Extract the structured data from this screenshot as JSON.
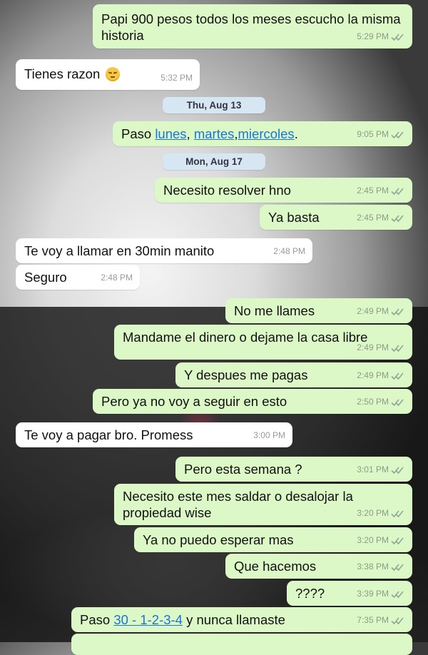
{
  "messages": [
    {
      "id": "m1",
      "dir": "out",
      "text": "Papi 900 pesos todos los meses escucho la misma historia",
      "time": "5:29 PM"
    },
    {
      "id": "m2",
      "dir": "in",
      "text": "Tienes razon",
      "emoji": "pensive-face",
      "time": "5:32 PM"
    },
    {
      "id": "d1",
      "type": "date",
      "text": "Thu, Aug 13"
    },
    {
      "id": "m3",
      "dir": "out",
      "prefix": "Paso ",
      "links": [
        "lunes",
        "martes",
        "miercoles"
      ],
      "separators": [
        ", ",
        ","
      ],
      "suffix": ".",
      "time": "9:05 PM"
    },
    {
      "id": "d2",
      "type": "date",
      "text": "Mon, Aug 17"
    },
    {
      "id": "m4",
      "dir": "out",
      "text": "Necesito resolver hno",
      "time": "2:45 PM"
    },
    {
      "id": "m5",
      "dir": "out",
      "text": "Ya basta",
      "time": "2:45 PM"
    },
    {
      "id": "m6",
      "dir": "in",
      "text": "Te voy a llamar en 30min manito",
      "time": "2:48 PM"
    },
    {
      "id": "m7",
      "dir": "in",
      "text": "Seguro",
      "time": "2:48 PM"
    },
    {
      "id": "m8",
      "dir": "out",
      "text": "No me llames",
      "time": "2:49 PM"
    },
    {
      "id": "m9",
      "dir": "out",
      "text": "Mandame el dinero o dejame la casa libre",
      "time": "2:49 PM"
    },
    {
      "id": "m10",
      "dir": "out",
      "text": "Y despues me pagas",
      "time": "2:49 PM"
    },
    {
      "id": "m11",
      "dir": "out",
      "text": "Pero ya no voy a seguir en esto",
      "time": "2:50 PM"
    },
    {
      "id": "m12",
      "dir": "in",
      "text": "Te voy a pagar bro. Promess",
      "time": "3:00 PM"
    },
    {
      "id": "m13",
      "dir": "out",
      "text": "Pero esta semana ?",
      "time": "3:01 PM"
    },
    {
      "id": "m14",
      "dir": "out",
      "text": "Necesito este mes saldar o desalojar la propiedad wise",
      "time": "3:20 PM"
    },
    {
      "id": "m15",
      "dir": "out",
      "text": "Ya no puedo esperar mas",
      "time": "3:20 PM"
    },
    {
      "id": "m16",
      "dir": "out",
      "text": "Que hacemos",
      "time": "3:38 PM"
    },
    {
      "id": "m17",
      "dir": "out",
      "text": "????",
      "time": "3:39 PM"
    },
    {
      "id": "m18",
      "dir": "out",
      "prefix": "Paso ",
      "link": "30 - 1-2-3-4",
      "suffix": " y nunca llamaste",
      "time": "7:35 PM"
    }
  ],
  "colors": {
    "outgoing": "#dcf8c6",
    "incoming": "#ffffff",
    "link": "#1a73d8",
    "date_chip": "#d6e6f2"
  },
  "icons": {
    "read_receipt": "double-check-icon",
    "emoji": "pensive-face-icon"
  }
}
